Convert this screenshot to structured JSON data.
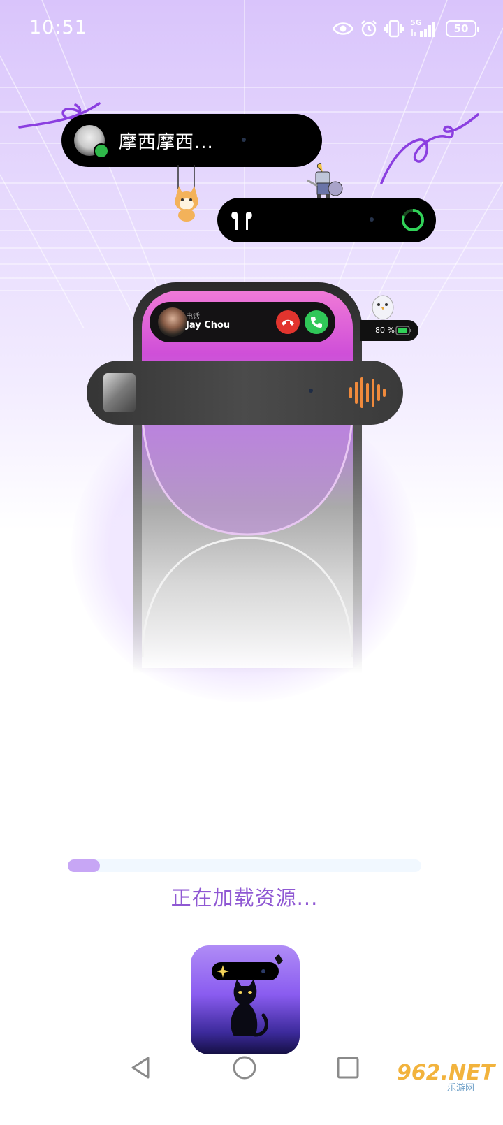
{
  "status_bar": {
    "time": "10:51",
    "signal": "5G",
    "battery": "50"
  },
  "notifications": {
    "message_text": "摩西摩西...",
    "call_label": "电话",
    "caller_name": "Jay Chou",
    "battery_text": "80 %"
  },
  "loading": {
    "progress_fraction": 0.09,
    "text": "正在加载资源..."
  },
  "watermark": {
    "brand": "962.NET",
    "sub": "乐游网"
  },
  "icons": [
    "eye-icon",
    "alarm-icon",
    "vibrate-icon",
    "signal-icon",
    "battery-icon",
    "wechat-icon",
    "airpods-icon",
    "decline-call-icon",
    "accept-call-icon",
    "waveform-icon",
    "back-icon",
    "home-icon",
    "recents-icon"
  ],
  "colors": {
    "accent": "#8f58d3",
    "progress": "#c7a6f5",
    "decline": "#e2342e",
    "accept": "#30c758",
    "waveform": "#f08a3c"
  }
}
